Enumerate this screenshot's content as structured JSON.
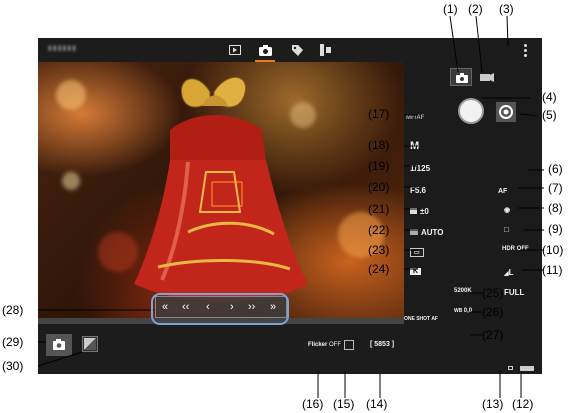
{
  "app": {
    "name": "▮▮▮▮▮▮"
  },
  "tabs": [
    {
      "icon": "playback-icon"
    },
    {
      "icon": "camera-icon",
      "active": true
    },
    {
      "icon": "tag-icon"
    },
    {
      "icon": "remote-icon"
    }
  ],
  "top_right": {
    "icon": "kebab-menu-icon"
  },
  "settings_left": {
    "mf_af": "MF/AF",
    "mode": "M",
    "shutter": "1/125",
    "aperture": "F5.6",
    "exposure_comp": "±0",
    "iso": "AUTO",
    "picture_style": "▭",
    "kind": "K"
  },
  "settings_right": {
    "af_method": "AF",
    "metering": "◉",
    "drive": "□",
    "hdr": "OFF",
    "quality": "L",
    "zoom": "FULL"
  },
  "wb": {
    "kelvin": "5200K",
    "shift": "0,0"
  },
  "af_op": "ONE SHOT AF",
  "status": {
    "flicker": "OFF",
    "remaining": "[ 5853 ]"
  },
  "accent": "#e67d1b",
  "callouts": {
    "c1": "(1)",
    "c2": "(2)",
    "c3": "(3)",
    "c4": "(4)",
    "c5": "(5)",
    "c6": "(6)",
    "c7": "(7)",
    "c8": "(8)",
    "c9": "(9)",
    "c10": "(10)",
    "c11": "(11)",
    "c12": "(12)",
    "c13": "(13)",
    "c14": "(14)",
    "c15": "(15)",
    "c16": "(16)",
    "c17": "(17)",
    "c18": "(18)",
    "c19": "(19)",
    "c20": "(20)",
    "c21": "(21)",
    "c22": "(22)",
    "c23": "(23)",
    "c24": "(24)",
    "c25": "(25)",
    "c26": "(26)",
    "c27": "(27)",
    "c28": "(28)",
    "c29": "(29)",
    "c30": "(30)"
  }
}
